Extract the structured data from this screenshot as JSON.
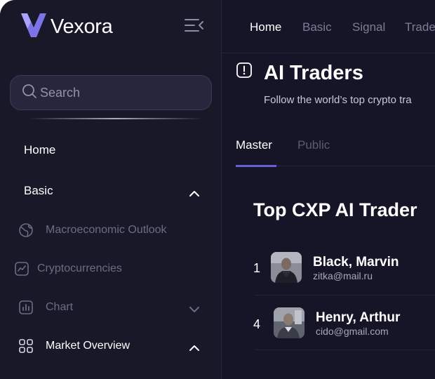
{
  "brand": {
    "name": "Vexora",
    "accent": "#7b74e6"
  },
  "sidebar": {
    "search_placeholder": "Search",
    "items": [
      {
        "label": "Home"
      },
      {
        "label": "Basic",
        "expanded": true
      },
      {
        "label": "Macroeconomic Outlook",
        "icon": "globe-icon"
      },
      {
        "label": "Cryptocurrencies",
        "icon": "trend-chart-icon"
      },
      {
        "label": "Chart",
        "icon": "bar-chart-icon",
        "expanded": false
      },
      {
        "label": "Market Overview",
        "icon": "grid-icon",
        "expanded": true
      }
    ]
  },
  "topnav": {
    "tabs": [
      "Home",
      "Basic",
      "Signal",
      "Trade"
    ],
    "active": "Home"
  },
  "page": {
    "title": "AI Traders",
    "subtitle": "Follow the world’s top crypto tra",
    "tabs": [
      "Master",
      "Public"
    ],
    "active_tab": "Master"
  },
  "leaderboard": {
    "title": "Top CXP AI Trader",
    "traders": [
      {
        "rank": "1",
        "name": "Black, Marvin",
        "email": "zitka@mail.ru"
      },
      {
        "rank": "4",
        "name": "Henry, Arthur",
        "email": "cido@gmail.com"
      }
    ]
  }
}
